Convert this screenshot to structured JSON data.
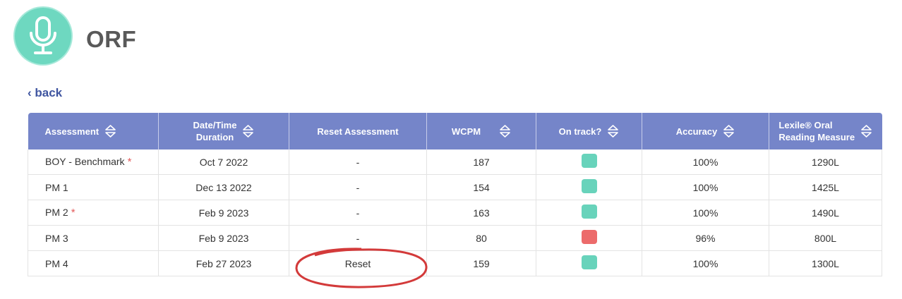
{
  "header": {
    "title": "ORF",
    "logo_icon": "microphone-icon",
    "logo_color": "#6ed8c0"
  },
  "nav": {
    "back_label": "‹ back"
  },
  "table": {
    "columns": [
      {
        "line1": "Assessment",
        "line2": "",
        "sortable": true
      },
      {
        "line1": "Date/Time",
        "line2": "Duration",
        "sortable": true
      },
      {
        "line1": "Reset Assessment",
        "line2": "",
        "sortable": false
      },
      {
        "line1": "WCPM",
        "line2": "",
        "sortable": true
      },
      {
        "line1": "On track?",
        "line2": "",
        "sortable": true
      },
      {
        "line1": "Accuracy",
        "line2": "",
        "sortable": true
      },
      {
        "line1": "Lexile® Oral",
        "line2": "Reading Measure",
        "sortable": true
      }
    ],
    "header_color": "#7585c9",
    "rows": [
      {
        "assessment": "BOY - Benchmark",
        "flag": "*",
        "date": "Oct 7 2022",
        "reset": "-",
        "wcpm": "187",
        "on_track": "green",
        "accuracy": "100%",
        "lexile": "1290L"
      },
      {
        "assessment": "PM 1",
        "flag": "",
        "date": "Dec 13 2022",
        "reset": "-",
        "wcpm": "154",
        "on_track": "green",
        "accuracy": "100%",
        "lexile": "1425L"
      },
      {
        "assessment": "PM 2",
        "flag": "*",
        "date": "Feb 9 2023",
        "reset": "-",
        "wcpm": "163",
        "on_track": "green",
        "accuracy": "100%",
        "lexile": "1490L"
      },
      {
        "assessment": "PM 3",
        "flag": "",
        "date": "Feb 9 2023",
        "reset": "-",
        "wcpm": "80",
        "on_track": "red",
        "accuracy": "96%",
        "lexile": "800L"
      },
      {
        "assessment": "PM 4",
        "flag": "",
        "date": "Feb 27 2023",
        "reset": "Reset",
        "wcpm": "159",
        "on_track": "green",
        "accuracy": "100%",
        "lexile": "1300L"
      }
    ]
  },
  "status_colors": {
    "green": "#68d3bb",
    "red": "#ec6b6b"
  },
  "annotation_color": "#d33a3a"
}
